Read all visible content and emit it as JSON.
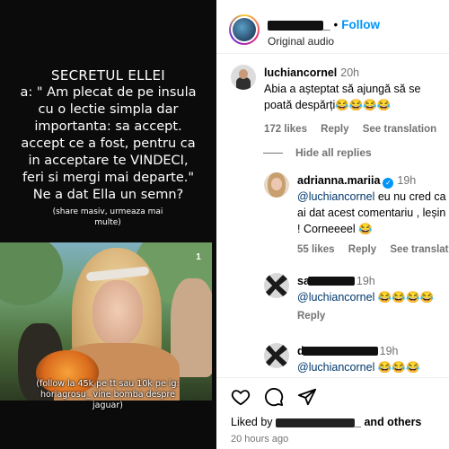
{
  "media": {
    "title": "SECRETUL ELLEI",
    "lines": [
      "a: \" Am plecat de pe insula",
      "cu o lectie simpla dar",
      "importanta: sa accept.",
      "accept ce a fost, pentru ca",
      "in acceptare te VINDECI,",
      "feri si mergi mai departe.\"",
      "Ne a dat Ella un semn?"
    ],
    "small_note": "(share masiv, urmeaza mai multe)",
    "caption": "(follow la 45k pe tt sau 10k pe ig: horiagrosu_ vine bomba despre jaguar)",
    "channel_logo": "1"
  },
  "header": {
    "username_tail": "_",
    "separator": "•",
    "follow_label": "Follow",
    "audio_label": "Original audio"
  },
  "comments": {
    "main": {
      "username": "luchiancornel",
      "time": "20h",
      "text": "Abia a așteptat să ajungă să se poată despărți😂😂😂😂",
      "likes": "172 likes",
      "reply": "Reply",
      "translate": "See translation"
    },
    "hide_replies": "Hide all replies",
    "replies": [
      {
        "username": "adrianna.mariia",
        "time": "19h",
        "mention": "@luchiancornel",
        "text": " eu nu cred ca ai dat acest comentariu , leșin ! Corneeeel 😂",
        "likes": "55 likes",
        "reply": "Reply",
        "translate": "See translation"
      },
      {
        "username_visible": "sa",
        "time": "19h",
        "mention": "@luchiancornel",
        "text": " 😂😂😂😂",
        "reply": "Reply"
      },
      {
        "username_visible": "d",
        "time": "19h",
        "mention": "@luchiancornel",
        "text": " 😂😂😂"
      }
    ]
  },
  "footer": {
    "liked_prefix": "Liked by",
    "liked_suffix": "and others",
    "ago": "20 hours ago"
  }
}
